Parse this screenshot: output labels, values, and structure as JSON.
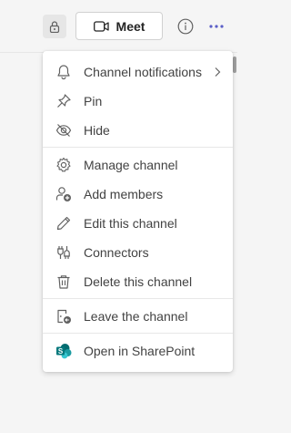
{
  "header": {
    "meet_label": "Meet"
  },
  "menu": {
    "items": [
      {
        "label": "Channel notifications",
        "icon": "bell-icon",
        "has_submenu": true
      },
      {
        "label": "Pin",
        "icon": "pin-icon"
      },
      {
        "label": "Hide",
        "icon": "eye-off-icon"
      },
      {
        "label": "Manage channel",
        "icon": "gear-icon"
      },
      {
        "label": "Add members",
        "icon": "person-add-icon"
      },
      {
        "label": "Edit this channel",
        "icon": "pencil-icon"
      },
      {
        "label": "Connectors",
        "icon": "plug-icon"
      },
      {
        "label": "Delete this channel",
        "icon": "trash-icon"
      },
      {
        "label": "Leave the channel",
        "icon": "leave-icon"
      },
      {
        "label": "Open in SharePoint",
        "icon": "sharepoint-icon"
      }
    ]
  },
  "colors": {
    "accent": "#5b5fc7",
    "sharepoint": "#03787c",
    "menu_background": "#ffffff",
    "page_background": "#f5f5f5"
  }
}
